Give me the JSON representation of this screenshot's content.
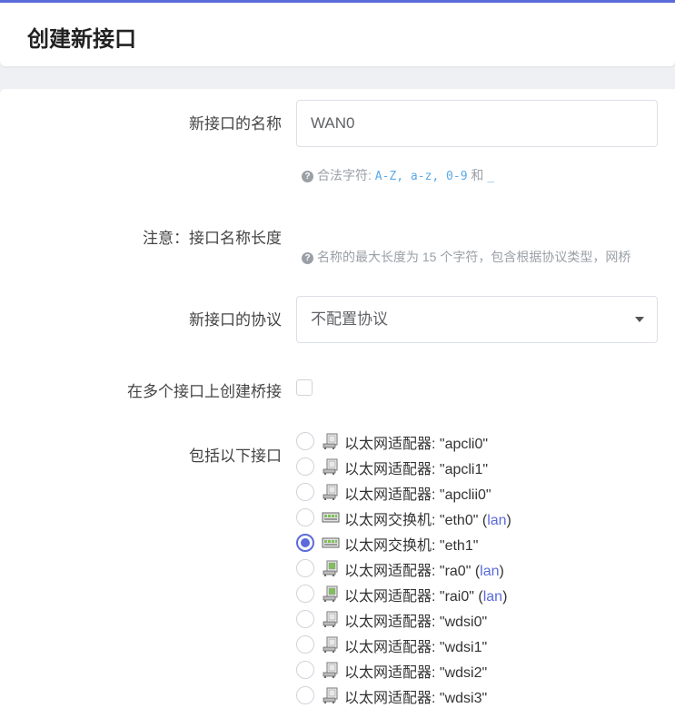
{
  "header": {
    "title": "创建新接口"
  },
  "form": {
    "name_label": "新接口的名称",
    "name_value": "WAN0",
    "name_hint_prefix": "合法字符:",
    "name_hint_chars": "A-Z, a-z, 0-9",
    "name_hint_and": "和",
    "name_hint_underscore": "_",
    "note_label": "注意：接口名称长度",
    "note_hint": "名称的最大长度为 15 个字符，包含根据协议类型，网桥",
    "protocol_label": "新接口的协议",
    "protocol_value": "不配置协议",
    "bridge_label": "在多个接口上创建桥接",
    "bridge_checked": false,
    "include_label": "包括以下接口"
  },
  "interfaces": [
    {
      "type": "adapter",
      "label": "以太网适配器: \"apcli0\"",
      "network": "",
      "checked": false
    },
    {
      "type": "adapter",
      "label": "以太网适配器: \"apcli1\"",
      "network": "",
      "checked": false
    },
    {
      "type": "adapter",
      "label": "以太网适配器: \"apclii0\"",
      "network": "",
      "checked": false
    },
    {
      "type": "switch",
      "label": "以太网交换机: \"eth0\"",
      "network": "lan",
      "checked": false
    },
    {
      "type": "switch",
      "label": "以太网交换机: \"eth1\"",
      "network": "",
      "checked": true
    },
    {
      "type": "adapter-up",
      "label": "以太网适配器: \"ra0\"",
      "network": "lan",
      "checked": false
    },
    {
      "type": "adapter-up",
      "label": "以太网适配器: \"rai0\"",
      "network": "lan",
      "checked": false
    },
    {
      "type": "adapter",
      "label": "以太网适配器: \"wdsi0\"",
      "network": "",
      "checked": false
    },
    {
      "type": "adapter",
      "label": "以太网适配器: \"wdsi1\"",
      "network": "",
      "checked": false
    },
    {
      "type": "adapter",
      "label": "以太网适配器: \"wdsi2\"",
      "network": "",
      "checked": false
    },
    {
      "type": "adapter",
      "label": "以太网适配器: \"wdsi3\"",
      "network": "",
      "checked": false
    }
  ],
  "colors": {
    "accent": "#5b6bdb",
    "hint": "#9aa0a6",
    "code": "#5aa9e6"
  }
}
